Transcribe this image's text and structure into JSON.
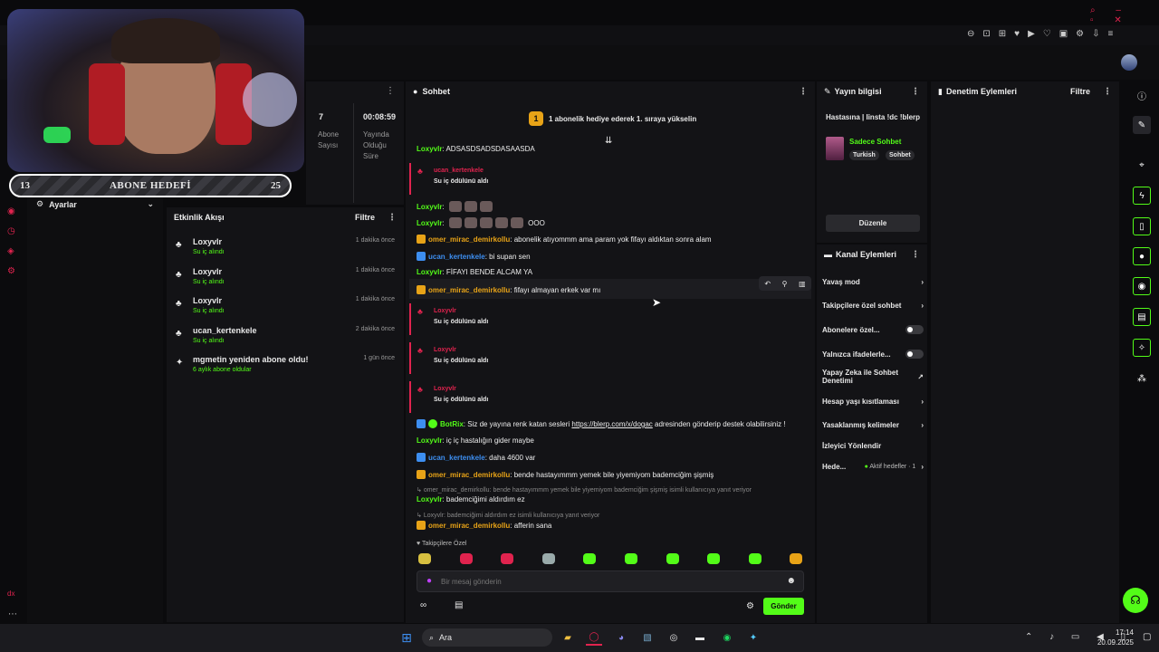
{
  "colors": {
    "accent": "#53fc18",
    "bg": "#0b0b0d",
    "panel": "#131316",
    "red": "#e0234e",
    "gold": "#e8a317",
    "blue": "#3d8ef0"
  },
  "goal": {
    "left": "13",
    "label": "ABONE HEDEFİ",
    "right": "25"
  },
  "settings": {
    "label": "Ayarlar"
  },
  "stats": {
    "subs": "7",
    "subs_label": "Abone Sayısı",
    "time": "00:08:59",
    "time_label": "Yayında Olduğu Süre"
  },
  "activity": {
    "title": "Etkinlik Akışı",
    "filter": "Filtre",
    "items": [
      {
        "name": "Loxyvlr",
        "sub": "Su iç alındı",
        "time": "1 dakika önce"
      },
      {
        "name": "Loxyvlr",
        "sub": "Su iç alındı",
        "time": "1 dakika önce"
      },
      {
        "name": "Loxyvlr",
        "sub": "Su iç alındı",
        "time": "1 dakika önce"
      },
      {
        "name": "ucan_kertenkele",
        "sub": "Su iç alındı",
        "time": "2 dakika önce"
      },
      {
        "name": "mgmetin yeniden abone oldu!",
        "sub": "6 aylık abone oldular",
        "time": "1 gün önce"
      }
    ]
  },
  "chat": {
    "title": "Sohbet",
    "pinned_rank": "1",
    "pinned": "1 abonelik hediye ederek 1. sıraya yükselin",
    "lines": [
      {
        "user": "Loxyvlr",
        "text": ": ADSASDSADSDASAASDA"
      },
      {
        "user": "ucan_kertenkele",
        "text": "Su iç ödülünü aldı"
      },
      {
        "user": "Loxyvlr",
        "text": ":"
      },
      {
        "user": "Loxyvlr",
        "text": ":"
      },
      {
        "user": "omer_mirac_demirkollu",
        "text": ": abonelik atıyommm ama param yok fifayı aldıktan sonra alam"
      },
      {
        "user": "ucan_kertenkele",
        "text": ": bi supan sen"
      },
      {
        "user": "Loxyvlr",
        "text": ": FİFAYI BENDE ALCAM YA"
      },
      {
        "user": "omer_mirac_demirkollu",
        "text": ": fifayı almayan erkek var mı"
      },
      {
        "user": "Loxyvlr",
        "text": "Su iç ödülünü aldı"
      },
      {
        "user": "Loxyvlr",
        "text": "Su iç ödülünü aldı"
      },
      {
        "user": "Loxyvlr",
        "text": "Su iç ödülünü aldı"
      },
      {
        "user": "BotRix",
        "text": ": Siz de yayına renk katan sesleri",
        "link": "https://blerp.com/x/dogac",
        "text2": " adresinden gönderip destek olabilirsiniz !"
      },
      {
        "user": "Loxyvlr",
        "text": ": iç iç hastalığın gider maybe"
      },
      {
        "user": "ucan_kertenkele",
        "text": ": daha 4600 var"
      },
      {
        "user": "omer_mirac_demirkollu",
        "text": ": bende hastayımmm yemek bile yiyemiyom bademciğim şişmiş"
      },
      {
        "reply": "omer_mirac_demirkollu: bende hastayımmm yemek bile yiyemiyom bademciğim şişmiş isimli kullanıcıya yanıt veriyor"
      },
      {
        "user": "Loxyvlr",
        "text": ": bademciğimi aldırdım ez"
      },
      {
        "reply": "Loxyvlr: bademciğimi aldırdım ez isimli kullanıcıya yanıt veriyor"
      },
      {
        "user": "omer_mirac_demirkollu",
        "text": ": afferin sana"
      }
    ],
    "extra_ooo": "OOO",
    "followers_only": "Takipçilere Özel",
    "input_placeholder": "Bir mesaj gönderin",
    "send": "Gönder"
  },
  "stream_info": {
    "title": "Yayın bilgisi",
    "stream_title": "Hastasına | Iinsta !dc !blerp",
    "category": "Sadece Sohbet",
    "tags": [
      "Turkish",
      "Sohbet"
    ],
    "edit": "Düzenle"
  },
  "channel_actions": {
    "title": "Kanal Eylemleri",
    "items": [
      {
        "label": "Yavaş mod",
        "kind": "arrow"
      },
      {
        "label": "Takipçilere özel sohbet",
        "kind": "arrow"
      },
      {
        "label": "Abonelere özel...",
        "kind": "toggle"
      },
      {
        "label": "Yalnızca ifadelerle...",
        "kind": "toggle"
      },
      {
        "label": "Yapay Zeka ile Sohbet Denetimi",
        "kind": "ext"
      },
      {
        "label": "Hesap yaşı kısıtlaması",
        "kind": "arrow"
      },
      {
        "label": "Yasaklanmış kelimeler",
        "kind": "arrow"
      },
      {
        "label": "İzleyici Yönlendir",
        "kind": "none"
      },
      {
        "label": "Hede...",
        "kind": "goal",
        "extra": "Aktif hedefler · 1"
      }
    ]
  },
  "moderation": {
    "title": "Denetim Eylemleri",
    "filter": "Filtre"
  },
  "taskbar": {
    "search": "Ara",
    "time": "17:14",
    "date": "20.09.2025"
  }
}
